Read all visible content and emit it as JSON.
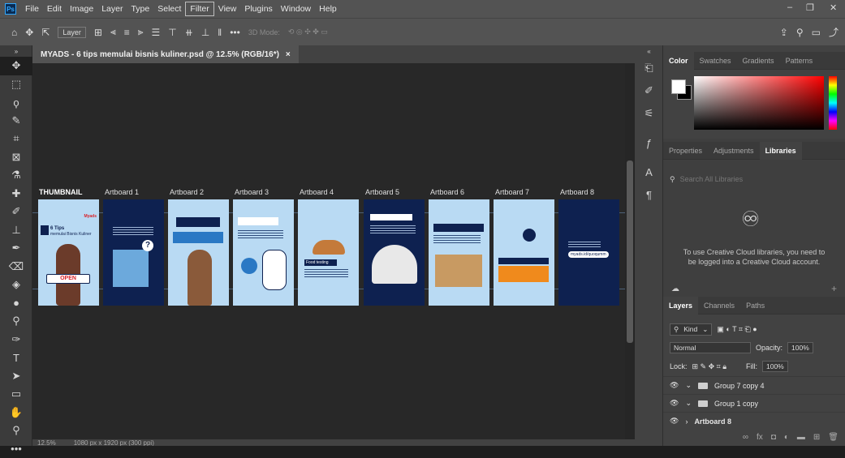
{
  "menubar": {
    "logo": "Ps",
    "items": [
      "File",
      "Edit",
      "Image",
      "Layer",
      "Type",
      "Select",
      "Filter",
      "View",
      "Plugins",
      "Window",
      "Help"
    ],
    "active_index": 6,
    "window_controls": [
      "–",
      "❐",
      "✕"
    ]
  },
  "options": {
    "layer_dropdown": "Layer",
    "mode_3d": "3D Mode:",
    "more": "•••"
  },
  "document": {
    "tab_title": "MYADS - 6 tips memulai bisnis kuliner.psd @ 12.5% (RGB/16*)",
    "close": "×"
  },
  "artboards": [
    {
      "label": "THUMBNAIL",
      "style": "light",
      "title": "6 Tips",
      "subtitle": "memulai Bisnis Kuliner",
      "brand": "Myads",
      "badge": "OPEN"
    },
    {
      "label": "Artboard 1",
      "style": "dark"
    },
    {
      "label": "Artboard 2",
      "style": "light"
    },
    {
      "label": "Artboard 3",
      "style": "light"
    },
    {
      "label": "Artboard 4",
      "style": "light",
      "caption": "Food testing"
    },
    {
      "label": "Artboard 5",
      "style": "dark"
    },
    {
      "label": "Artboard 6",
      "style": "light"
    },
    {
      "label": "Artboard 7",
      "style": "light"
    },
    {
      "label": "Artboard 8",
      "style": "dark",
      "url": "myads.id/quoqumm"
    }
  ],
  "statusbar": {
    "zoom": "12.5%",
    "size": "1080 px x 1920 px (300 ppi)"
  },
  "color_panel": {
    "tabs": [
      "Color",
      "Swatches",
      "Gradients",
      "Patterns"
    ],
    "active_index": 0,
    "foreground": "#ffffff",
    "background": "#000000"
  },
  "libraries_panel": {
    "tabs": [
      "Properties",
      "Adjustments",
      "Libraries"
    ],
    "active_index": 2,
    "search_placeholder": "Search All Libraries",
    "message": "To use Creative Cloud libraries, you need to be logged into a Creative Cloud account."
  },
  "layers_panel": {
    "tabs": [
      "Layers",
      "Channels",
      "Paths"
    ],
    "active_index": 0,
    "kind": "Kind",
    "blend_mode": "Normal",
    "opacity_label": "Opacity:",
    "opacity_value": "100%",
    "lock_label": "Lock:",
    "fill_label": "Fill:",
    "fill_value": "100%",
    "layers": [
      {
        "name": "Group 7 copy 4",
        "type": "group"
      },
      {
        "name": "Group 1 copy",
        "type": "group"
      },
      {
        "name": "Artboard 8",
        "type": "artboard"
      }
    ]
  }
}
